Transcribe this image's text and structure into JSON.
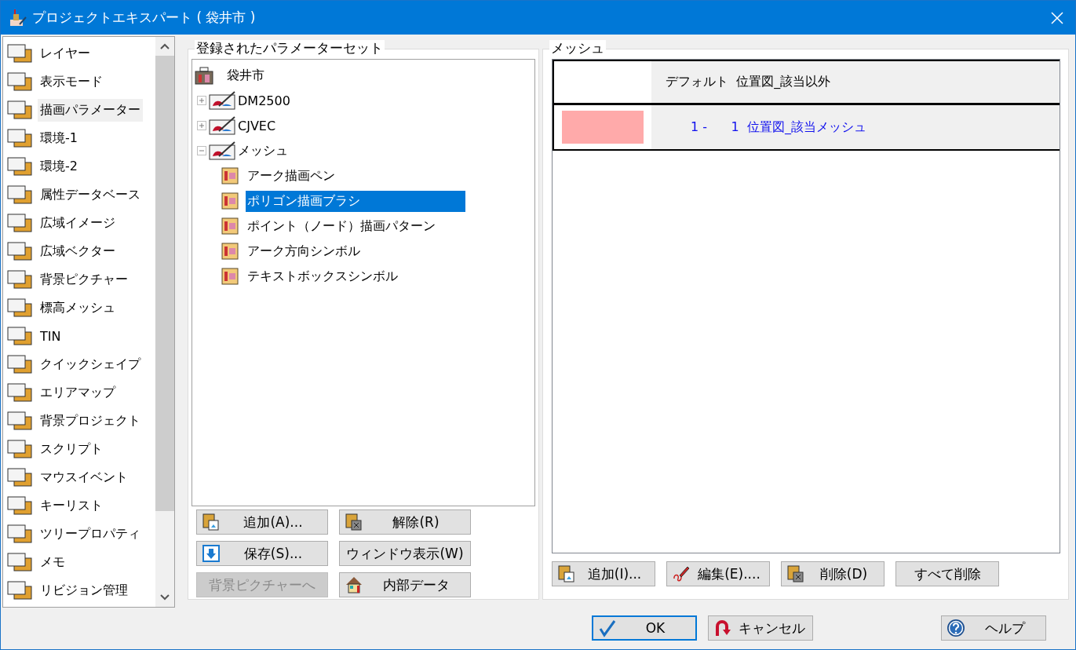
{
  "window": {
    "title": "プロジェクトエキスパート ( 袋井市 )"
  },
  "sidebar": {
    "items": [
      {
        "label": "レイヤー",
        "selected": false
      },
      {
        "label": "表示モード",
        "selected": false
      },
      {
        "label": "描画パラメーター",
        "selected": true
      },
      {
        "label": "環境-1",
        "selected": false
      },
      {
        "label": "環境-2",
        "selected": false
      },
      {
        "label": "属性データベース",
        "selected": false
      },
      {
        "label": "広域イメージ",
        "selected": false
      },
      {
        "label": "広域ベクター",
        "selected": false
      },
      {
        "label": "背景ピクチャー",
        "selected": false
      },
      {
        "label": "標高メッシュ",
        "selected": false
      },
      {
        "label": "TIN",
        "selected": false
      },
      {
        "label": "クイックシェイプ",
        "selected": false
      },
      {
        "label": "エリアマップ",
        "selected": false
      },
      {
        "label": "背景プロジェクト",
        "selected": false
      },
      {
        "label": "スクリプト",
        "selected": false
      },
      {
        "label": "マウスイベント",
        "selected": false
      },
      {
        "label": "キーリスト",
        "selected": false
      },
      {
        "label": "ツリープロパティ",
        "selected": false
      },
      {
        "label": "メモ",
        "selected": false
      },
      {
        "label": "リビジョン管理",
        "selected": false
      }
    ]
  },
  "parameter_sets": {
    "title": "登録されたパラメーターセット",
    "tree": {
      "label": "袋井市",
      "children": [
        {
          "label": "DM2500",
          "expanded": false
        },
        {
          "label": "CJVEC",
          "expanded": false
        },
        {
          "label": "メッシュ",
          "expanded": true,
          "children": [
            {
              "label": "アーク描画ペン",
              "selected": false
            },
            {
              "label": "ポリゴン描画ブラシ",
              "selected": true
            },
            {
              "label": "ポイント（ノード）描画パターン",
              "selected": false
            },
            {
              "label": "アーク方向シンボル",
              "selected": false
            },
            {
              "label": "テキストボックスシンボル",
              "selected": false
            }
          ]
        }
      ]
    },
    "buttons": [
      {
        "label": "追加(A)...",
        "kind": "add",
        "disabled": false
      },
      {
        "label": "解除(R)",
        "kind": "remove",
        "disabled": false
      },
      {
        "label": "保存(S)...",
        "kind": "save",
        "disabled": false
      },
      {
        "label": "ウィンドウ表示(W)",
        "kind": "plain",
        "disabled": false
      },
      {
        "label": "背景ピクチャーへ",
        "kind": "plain",
        "disabled": true
      },
      {
        "label": "内部データ",
        "kind": "home",
        "disabled": false
      }
    ]
  },
  "mesh": {
    "title": "メッシュ",
    "rows": [
      {
        "text": "デフォルト  位置図_該当以外",
        "color": "#ffffff",
        "kind": "default"
      },
      {
        "text": "1 -      1  位置図_該当メッシュ",
        "color": "#ffaaaa",
        "kind": "range"
      }
    ],
    "buttons": [
      {
        "label": "追加(I)...",
        "kind": "add"
      },
      {
        "label": "編集(E)....",
        "kind": "edit"
      },
      {
        "label": "削除(D)",
        "kind": "remove"
      },
      {
        "label": "すべて削除",
        "kind": "plain"
      }
    ]
  },
  "footer": {
    "buttons": [
      {
        "label": "OK",
        "kind": "ok",
        "default": true
      },
      {
        "label": "キャンセル",
        "kind": "cancel",
        "default": false
      },
      {
        "label": "ヘルプ",
        "kind": "help",
        "default": false
      }
    ]
  }
}
